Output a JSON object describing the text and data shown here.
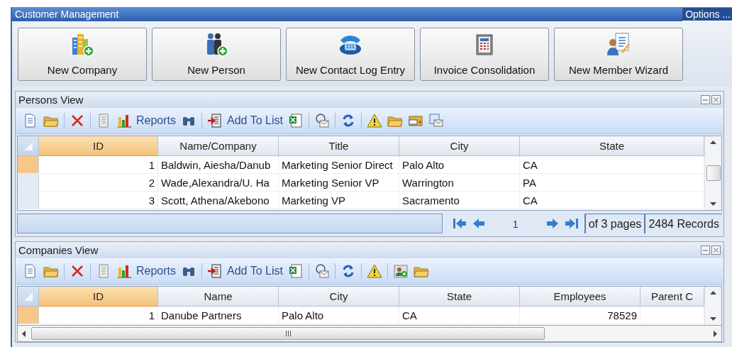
{
  "window": {
    "title": "Customer Management",
    "options_label": "Options ..."
  },
  "actions": [
    {
      "label": "New Company"
    },
    {
      "label": "New Person"
    },
    {
      "label": "New Contact Log Entry"
    },
    {
      "label": "Invoice Consolidation"
    },
    {
      "label": "New Member Wizard"
    }
  ],
  "panels": [
    {
      "title": "Persons View",
      "toolbar": {
        "reports_label": "Reports",
        "add_to_list_label": "Add To List"
      },
      "table": {
        "columns": [
          {
            "label": "ID",
            "kind": "number",
            "selected": true
          },
          {
            "label": "Name/Company",
            "kind": "text",
            "selected": false
          },
          {
            "label": "Title",
            "kind": "text",
            "selected": false
          },
          {
            "label": "City",
            "kind": "text",
            "selected": false
          },
          {
            "label": "State",
            "kind": "text",
            "selected": false
          }
        ],
        "rows": [
          {
            "selected": true,
            "cells": [
              "1",
              "Baldwin, Aiesha/Danub",
              "Marketing Senior Direct",
              "Palo Alto",
              "CA"
            ]
          },
          {
            "selected": false,
            "cells": [
              "2",
              "Wade,Alexandra/U. Ha",
              "Marketing Senior VP",
              "Warrington",
              "PA"
            ]
          },
          {
            "selected": false,
            "cells": [
              "3",
              "Scott, Athena/Akebono",
              "Marketing VP",
              "Sacramento",
              "CA"
            ]
          }
        ]
      },
      "pager": {
        "page": "1",
        "pages_label": "of 3 pages",
        "records_label": "2484 Records"
      }
    },
    {
      "title": "Companies View",
      "toolbar": {
        "reports_label": "Reports",
        "add_to_list_label": "Add To List"
      },
      "table": {
        "columns": [
          {
            "label": "ID",
            "kind": "number",
            "selected": true
          },
          {
            "label": "Name",
            "kind": "text",
            "selected": false
          },
          {
            "label": "City",
            "kind": "text",
            "selected": false
          },
          {
            "label": "State",
            "kind": "text",
            "selected": false
          },
          {
            "label": "Employees",
            "kind": "number",
            "selected": false
          },
          {
            "label": "Parent C",
            "selected": false
          }
        ],
        "rows": [
          {
            "selected": true,
            "cells": [
              "1",
              "Danube Partners",
              "Palo Alto",
              "CA",
              "78529"
            ]
          }
        ]
      }
    }
  ]
}
